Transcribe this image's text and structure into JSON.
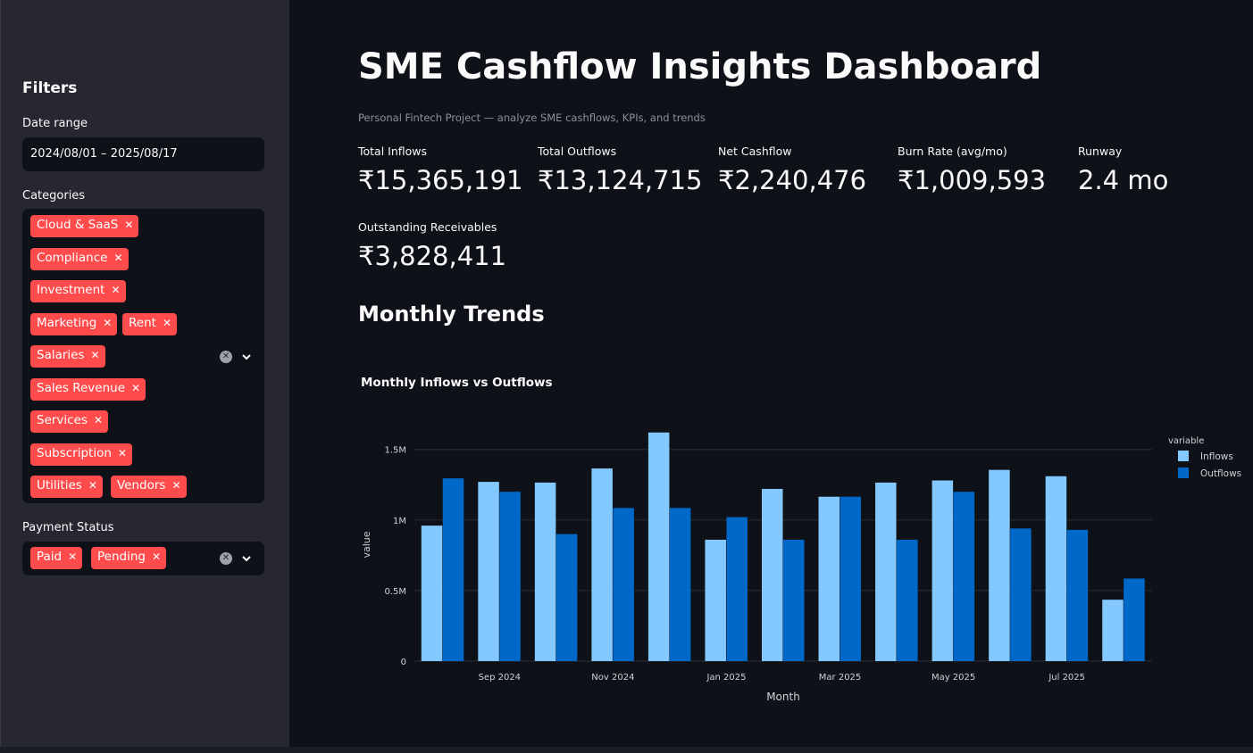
{
  "sidebar": {
    "title": "Filters",
    "date_range": {
      "label": "Date range",
      "value": "2024/08/01 – 2025/08/17"
    },
    "categories": {
      "label": "Categories",
      "selected": [
        "Cloud & SaaS",
        "Compliance",
        "Investment",
        "Marketing",
        "Rent",
        "Salaries",
        "Sales Revenue",
        "Services",
        "Subscription",
        "Utilities",
        "Vendors"
      ]
    },
    "payment_status": {
      "label": "Payment Status",
      "selected": [
        "Paid",
        "Pending"
      ]
    },
    "chip_remove_icon": "x-icon",
    "clear_icon": "clear-circle-icon",
    "dropdown_icon": "chevron-down-icon"
  },
  "header": {
    "title": "SME Cashflow Insights Dashboard",
    "subtitle": "Personal Fintech Project — analyze SME cashflows, KPIs, and trends"
  },
  "metrics": [
    {
      "label": "Total Inflows",
      "value": "₹15,365,191"
    },
    {
      "label": "Total Outflows",
      "value": "₹13,124,715"
    },
    {
      "label": "Net Cashflow",
      "value": "₹2,240,476"
    },
    {
      "label": "Burn Rate (avg/mo)",
      "value": "₹1,009,593"
    },
    {
      "label": "Runway",
      "value": "2.4 mo"
    },
    {
      "label": "Outstanding Receivables",
      "value": "₹3,828,411"
    }
  ],
  "section": {
    "title": "Monthly Trends"
  },
  "colors": {
    "accent": "#ff4b4b",
    "inflows": "#83c9ff",
    "outflows": "#0068c9",
    "background": "#0e1117",
    "sidebar": "#262730"
  },
  "chart_data": {
    "type": "bar",
    "title": "Monthly Inflows vs Outflows",
    "xlabel": "Month",
    "ylabel": "value",
    "legend_title": "variable",
    "legend_position": "top-right",
    "categories": [
      "Aug 2024",
      "Sep 2024",
      "Oct 2024",
      "Nov 2024",
      "Dec 2024",
      "Jan 2025",
      "Feb 2025",
      "Mar 2025",
      "Apr 2025",
      "May 2025",
      "Jun 2025",
      "Jul 2025",
      "Aug 2025"
    ],
    "x_tick_labels": [
      "Sep 2024",
      "Nov 2024",
      "Jan 2025",
      "Mar 2025",
      "May 2025",
      "Jul 2025"
    ],
    "y_ticks": [
      0,
      500000,
      1000000,
      1500000
    ],
    "y_tick_labels": [
      "0",
      "0.5M",
      "1M",
      "1.5M"
    ],
    "ylim": [
      0,
      1650000
    ],
    "grid": true,
    "series": [
      {
        "name": "Inflows",
        "values": [
          960000,
          1270000,
          1265000,
          1365000,
          1620000,
          860000,
          1220000,
          1165000,
          1265000,
          1280000,
          1355000,
          1310000,
          435000
        ]
      },
      {
        "name": "Outflows",
        "values": [
          1295000,
          1200000,
          900000,
          1085000,
          1085000,
          1020000,
          860000,
          1165000,
          860000,
          1200000,
          940000,
          930000,
          585000
        ]
      }
    ]
  }
}
